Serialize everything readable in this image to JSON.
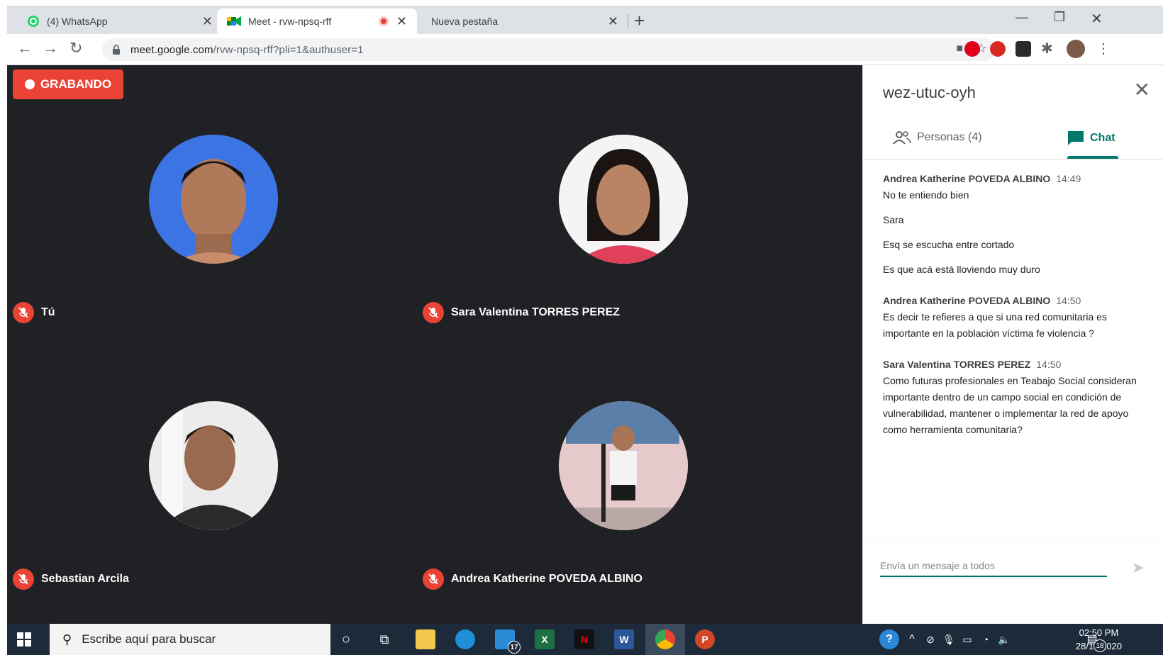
{
  "browser": {
    "tabs": [
      {
        "title": "(4) WhatsApp"
      },
      {
        "title": "Meet - rvw-npsq-rff"
      },
      {
        "title": "Nueva pestaña"
      }
    ],
    "url_host": "meet.google.com",
    "url_path": "/rvw-npsq-rff?pli=1&authuser=1"
  },
  "meet": {
    "recording_label": "GRABANDO",
    "participants": [
      {
        "name": "Tú"
      },
      {
        "name": "Sara Valentina TORRES PEREZ"
      },
      {
        "name": "Sebastian Arcila"
      },
      {
        "name": "Andrea Katherine POVEDA ALBINO"
      }
    ]
  },
  "panel": {
    "meeting_code": "wez-utuc-oyh",
    "people_tab": "Personas (4)",
    "chat_tab": "Chat",
    "compose_placeholder": "Envía un mensaje a todos",
    "messages": [
      {
        "sender": "Andrea Katherine POVEDA ALBINO",
        "time": "14:49",
        "texts": [
          "No te entiendo bien",
          "Sara",
          "Esq se escucha entre cortado",
          "Es que acá está lloviendo muy duro"
        ]
      },
      {
        "sender": "Andrea Katherine POVEDA ALBINO",
        "time": "14:50",
        "texts": [
          "Es decir te refieres a que si una red comunitaria es importante en la población víctima fe violencia ?"
        ]
      },
      {
        "sender": "Sara Valentina TORRES PEREZ",
        "time": "14:50",
        "texts": [
          "Como futuras profesionales en Teabajo Social consideran importante dentro de un campo social en condición de vulnerabilidad, mantener o implementar la red de apoyo como herramienta comunitaria?"
        ]
      }
    ]
  },
  "taskbar": {
    "search_placeholder": "Escribe aquí para buscar",
    "mail_badge": "17",
    "clock_time": "02:50 PM",
    "clock_date": "28/10/2020",
    "notification_count": "18"
  },
  "colors": {
    "meet_bg": "#202124",
    "record_red": "#ea4335",
    "chat_accent": "#00796b"
  }
}
